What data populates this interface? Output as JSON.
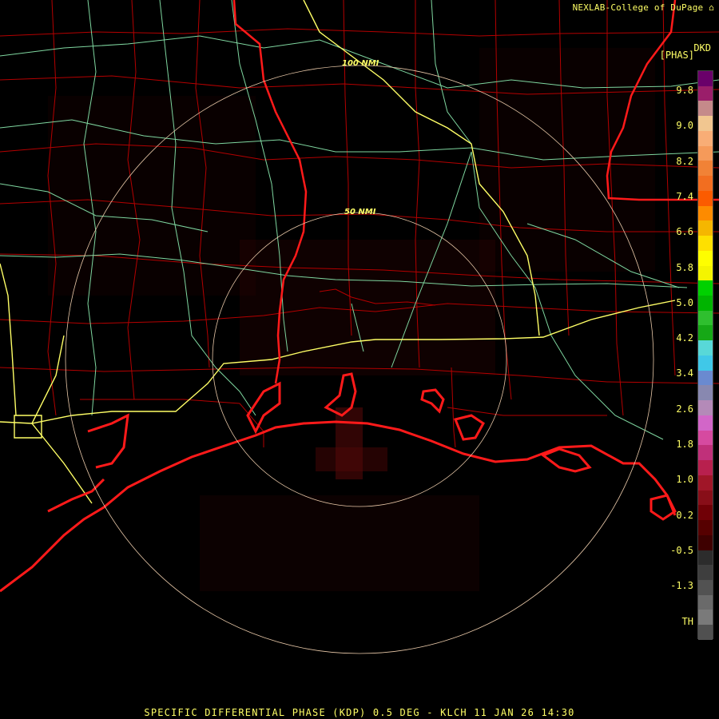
{
  "header": {
    "credit": "NEXLAB-College of DuPage",
    "credit_icon": "cod-logo-icon",
    "product_code": "DKD",
    "product_units": "[PHAS]"
  },
  "colorbar": {
    "steps": [
      "#6a006a",
      "#9a1e6a",
      "#c58a8a",
      "#f1c690",
      "#f8ad76",
      "#f59a5a",
      "#f18236",
      "#f26e20",
      "#fb5b00",
      "#fd8b00",
      "#f5b600",
      "#fee000",
      "#fefe00",
      "#f4f400",
      "#00d100",
      "#00b400",
      "#2fbf2f",
      "#16a816",
      "#58d8d8",
      "#40c8e8",
      "#6a8ad0",
      "#8888b0",
      "#b48ab8",
      "#d266c8",
      "#d64aa0",
      "#c0307a",
      "#b8204e",
      "#a01628",
      "#880e18",
      "#700006",
      "#560000",
      "#3e0000",
      "#2c2c2c",
      "#3e3e3e",
      "#525252",
      "#6a6a6a",
      "#7a7a7a",
      "#505050"
    ],
    "labels": [
      "9.8",
      "9.0",
      "8.2",
      "7.4",
      "6.6",
      "5.8",
      "5.0",
      "4.2",
      "3.4",
      "2.6",
      "1.8",
      "1.0",
      "0.2",
      "-0.5",
      "-1.3",
      "TH"
    ]
  },
  "map": {
    "range_ring_inner_label": "50 NMI",
    "range_ring_outer_label": "100 NMI",
    "colors": {
      "background": "#000000",
      "coastline": "#ff1a1a",
      "county_lines": "#b40000",
      "highways": "#7fd7a0",
      "interstates": "#ffff66",
      "range_rings": "#e8c8a8",
      "echo": "#7a0f0f"
    }
  },
  "footer": {
    "caption": "SPECIFIC DIFFERENTIAL PHASE (KDP) 0.5 DEG - KLCH 11 JAN 26 14:30"
  }
}
